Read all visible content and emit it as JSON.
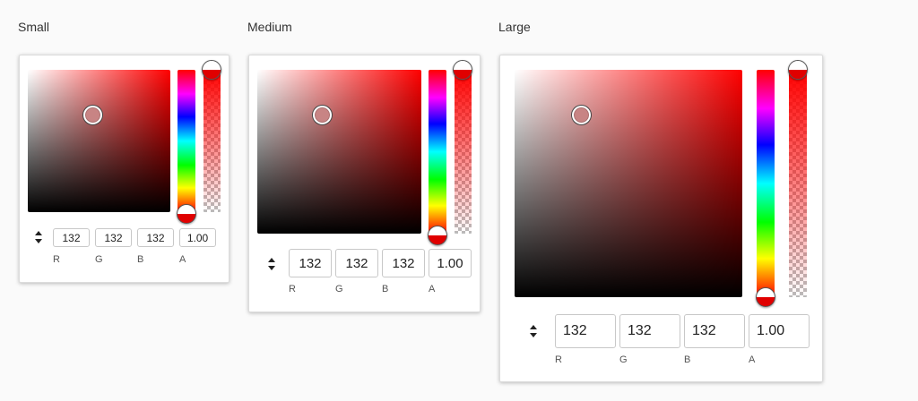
{
  "pickers": [
    {
      "title": "Small",
      "r": "132",
      "g": "132",
      "b": "132",
      "a": "1.00"
    },
    {
      "title": "Medium",
      "r": "132",
      "g": "132",
      "b": "132",
      "a": "1.00"
    },
    {
      "title": "Large",
      "r": "132",
      "g": "132",
      "b": "132",
      "a": "1.00"
    }
  ],
  "channel_labels": {
    "r": "R",
    "g": "G",
    "b": "B",
    "a": "A"
  },
  "colors": {
    "selected_hue": "#ff0000",
    "selected_color": "#c88484"
  },
  "icons": {
    "mode_toggle": "up-down-arrows-icon"
  }
}
